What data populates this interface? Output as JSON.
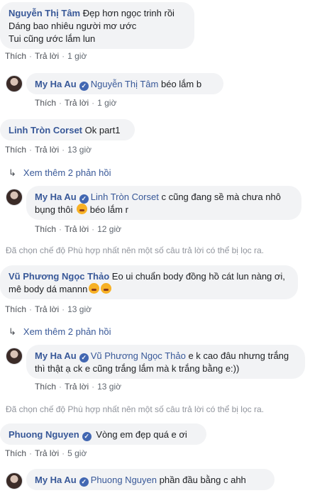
{
  "actions": {
    "like": "Thích",
    "reply": "Trả lời",
    "dot": "·"
  },
  "verified_icon": "verified-check-icon",
  "c1": {
    "name": "Nguyễn Thị Tâm",
    "line1": " Đẹp hơn ngọc trinh rồi",
    "line2": "Dáng bao nhiêu người mơ ước",
    "line3": "Tui cũng ước lắm lun",
    "time": "1 giờ"
  },
  "r1": {
    "name": "My Ha Au",
    "tag": "Nguyễn Thị Tâm",
    "text": " béo lắm b",
    "time": "1 giờ"
  },
  "c2": {
    "name": "Linh Tròn Corset",
    "text": " Ok part1",
    "time": "13 giờ"
  },
  "more1": {
    "text": "Xem thêm 2 phản hồi",
    "icon": "reply-arrow-icon"
  },
  "r2": {
    "name": "My Ha Au",
    "tag": "Linh Tròn Corset",
    "line1": " c cũng đang sề mà chưa nhô",
    "line2a": "bụng thôi ",
    "line2b": " béo lắm r",
    "emoji": "rolling-laugh-emoji",
    "time": "12 giờ"
  },
  "note1": "Đã chọn chế độ Phù hợp nhất nên một số câu trả lời có thể bị lọc ra.",
  "c3": {
    "name": "Vũ Phương Ngọc Thảo",
    "line1": " Eo ui chuẩn body đồng hồ cát lun nàng ơi,",
    "line2": "mê body dá mannn",
    "emoji": "crying-emoji",
    "time": "13 giờ"
  },
  "more2": {
    "text": "Xem thêm 2 phản hồi"
  },
  "r3": {
    "name": "My Ha Au",
    "tag": "Vũ Phương Ngọc Thảo",
    "line1": " e k cao đâu nhưng trắng",
    "line2": "thì thật ạ ck e cũng trắng lắm mà k trắng bằng e:))",
    "time": "13 giờ"
  },
  "note2": "Đã chọn chế độ Phù hợp nhất nên một số câu trả lời có thể bị lọc ra.",
  "c4": {
    "name": "Phuong Nguyen",
    "text": " Vòng em đẹp quá e ơi",
    "time": "5 giờ"
  },
  "r4": {
    "name": "My Ha Au",
    "tag": "Phuong Nguyen",
    "text": " phần đầu bằng c ahh"
  }
}
